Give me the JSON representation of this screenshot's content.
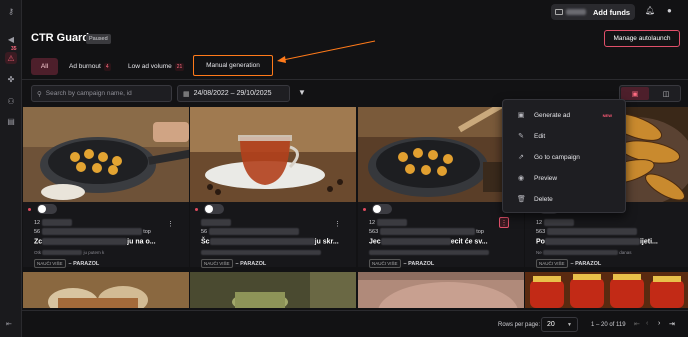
{
  "topbar": {
    "add_funds_label": "Add funds"
  },
  "sidebar": {
    "badge": "35"
  },
  "header": {
    "title": "CTR Guard",
    "status": "Paused",
    "manage_label": "Manage autolaunch"
  },
  "tabs": [
    {
      "label": "All"
    },
    {
      "label": "Ad burnout",
      "count": "4"
    },
    {
      "label": "Low ad volume",
      "count": "21"
    },
    {
      "label": "Manual generation"
    }
  ],
  "filters": {
    "search_placeholder": "Search by campaign name, id",
    "date_range": "24/08/2022 – 29/10/2025"
  },
  "cards": [
    {
      "id_prefix": "12",
      "sub_prefix": "56",
      "sub_suffix": "top",
      "name_prefix": "Zc",
      "name_suffix": "ju na o...",
      "desc_prefix": "Otk",
      "desc_suffix": "ju putem k",
      "brand_chip": "NAUČI VIŠE",
      "brand": "– PARAZOL"
    },
    {
      "id_prefix": "",
      "sub_prefix": "56",
      "sub_suffix": "",
      "name_prefix": "Šc",
      "name_suffix": "ju skr...",
      "desc_prefix": "",
      "desc_suffix": "",
      "brand_chip": "NAUČI VIŠE",
      "brand": "– PARAZOL"
    },
    {
      "id_prefix": "12",
      "sub_prefix": "563",
      "sub_suffix": "top",
      "name_prefix": "Jec",
      "name_suffix": "ecit će sv...",
      "desc_prefix": "",
      "desc_suffix": "",
      "brand_chip": "NAUČI VIŠE",
      "brand": "– PARAZOL"
    },
    {
      "id_prefix": "12",
      "sub_prefix": "563",
      "sub_suffix": "",
      "name_prefix": "Po",
      "name_suffix": "ijeti...",
      "desc_prefix": "Ne",
      "desc_suffix": "danas",
      "brand_chip": "NAUČI VIŠE",
      "brand": "– PARAZOL"
    }
  ],
  "menu": [
    {
      "label": "Generate ad",
      "icon": "sparkle-image-icon",
      "badge": "NEW"
    },
    {
      "label": "Edit",
      "icon": "pencil-icon"
    },
    {
      "label": "Go to campaign",
      "icon": "external-link-icon"
    },
    {
      "label": "Preview",
      "icon": "eye-icon"
    },
    {
      "label": "Delete",
      "icon": "trash-icon"
    }
  ],
  "footer": {
    "rows_label": "Rows per page:",
    "rows_value": "20",
    "range": "1 – 20 of 119"
  },
  "colors": {
    "accent": "#e0506a",
    "highlight_border": "#ff7a1a",
    "background": "#121214"
  }
}
